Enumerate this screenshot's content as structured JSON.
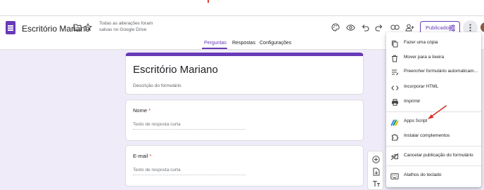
{
  "header": {
    "title": "Escritório Mariano",
    "save_status": "Todas as alterações foram salvas no Google Drive",
    "publish_label": "Publicado"
  },
  "tabs": [
    "Perguntas",
    "Respostas",
    "Configurações"
  ],
  "form": {
    "title": "Escritório Mariano",
    "description_placeholder": "Descrição do formulário",
    "questions": [
      {
        "label": "Nome",
        "required_mark": "*",
        "answer_placeholder": "Texto de resposta curta"
      },
      {
        "label": "E-mail",
        "required_mark": "*",
        "answer_placeholder": "Texto de resposta curta"
      }
    ]
  },
  "menu": {
    "items": [
      {
        "label": "Fazer uma cópia",
        "icon": "copy-icon"
      },
      {
        "label": "Mover para a lixeira",
        "icon": "trash-icon"
      },
      {
        "label": "Preencher formulário automaticam...",
        "icon": "autofill-icon"
      },
      {
        "label": "Incorporar HTML",
        "icon": "code-icon"
      },
      {
        "label": "Imprimir",
        "icon": "print-icon"
      },
      {
        "label": "Apps Script",
        "icon": "apps-script-icon"
      },
      {
        "label": "Instalar complementos",
        "icon": "puzzle-icon"
      },
      {
        "label": "Cancelar publicação do formulário",
        "icon": "unpublish-icon"
      },
      {
        "label": "Atalhos do teclado",
        "icon": "keyboard-icon"
      }
    ]
  },
  "colors": {
    "accent": "#673ab7",
    "background": "#f0ebf8",
    "annotation_arrow": "#d93025"
  }
}
